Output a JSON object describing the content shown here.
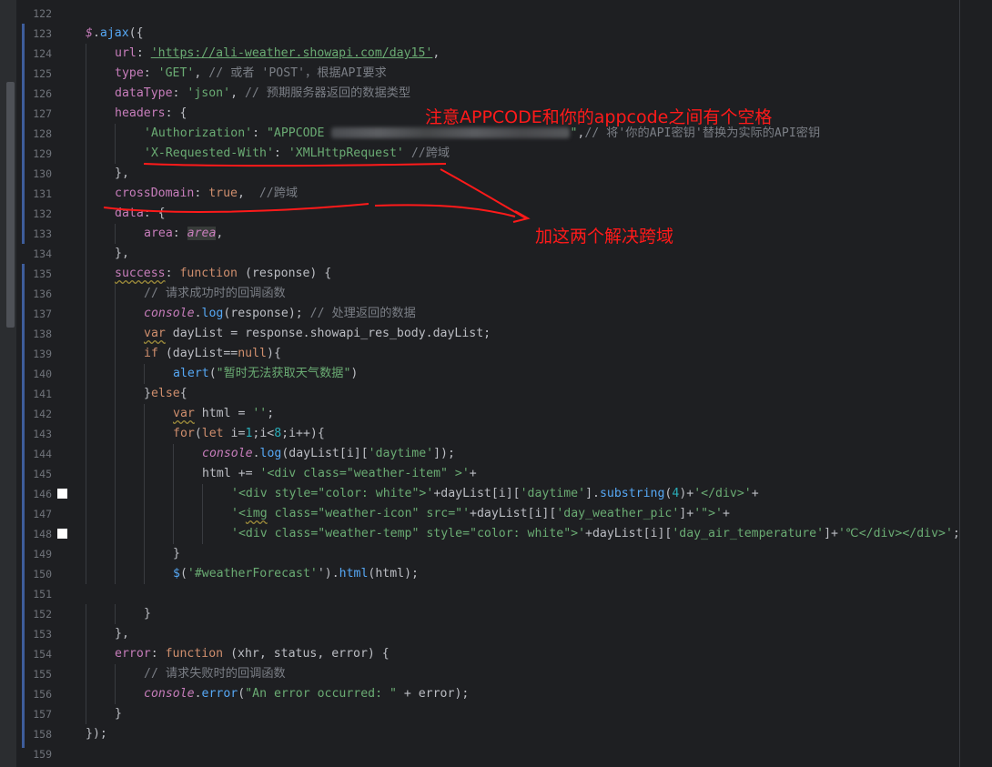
{
  "lines": [
    {
      "n": "122",
      "indent": 0,
      "bp": false,
      "t": []
    },
    {
      "n": "123",
      "indent": 0,
      "bp": false,
      "t": [
        [
          "g",
          "$"
        ],
        [
          "d",
          "."
        ],
        [
          "f",
          "ajax"
        ],
        [
          "d",
          "({"
        ]
      ]
    },
    {
      "n": "124",
      "indent": 1,
      "bp": false,
      "t": [
        [
          "p",
          "url"
        ],
        [
          "d",
          ": "
        ],
        [
          "s2",
          "'https://ali-weather.showapi.com/day15'"
        ],
        [
          "d",
          ","
        ]
      ]
    },
    {
      "n": "125",
      "indent": 1,
      "bp": false,
      "t": [
        [
          "p",
          "type"
        ],
        [
          "d",
          ": "
        ],
        [
          "s",
          "'GET'"
        ],
        [
          "d",
          ", "
        ],
        [
          "c",
          "// 或者 'POST'，根据API要求"
        ]
      ]
    },
    {
      "n": "126",
      "indent": 1,
      "bp": false,
      "t": [
        [
          "p",
          "dataType"
        ],
        [
          "d",
          ": "
        ],
        [
          "s",
          "'json'"
        ],
        [
          "d",
          ", "
        ],
        [
          "c",
          "// 预期服务器返回的数据类型"
        ]
      ]
    },
    {
      "n": "127",
      "indent": 1,
      "bp": false,
      "t": [
        [
          "p",
          "headers"
        ],
        [
          "d",
          ": {"
        ]
      ]
    },
    {
      "n": "128",
      "indent": 2,
      "bp": false,
      "t": [
        [
          "s",
          "'Authorization'"
        ],
        [
          "d",
          ": "
        ],
        [
          "s",
          "\"APPCODE "
        ],
        [
          "blur",
          ""
        ],
        [
          "s",
          "\""
        ],
        [
          "d",
          ","
        ],
        [
          "c",
          "// 将'你的API密钥'替换为实际的API密钥"
        ]
      ]
    },
    {
      "n": "129",
      "indent": 2,
      "bp": false,
      "t": [
        [
          "s",
          "'X-Requested-With'"
        ],
        [
          "d",
          ": "
        ],
        [
          "s",
          "'XMLHttpRequest'"
        ],
        [
          "d",
          " "
        ],
        [
          "c",
          "//跨域"
        ]
      ]
    },
    {
      "n": "130",
      "indent": 1,
      "bp": false,
      "t": [
        [
          "d",
          "},"
        ]
      ]
    },
    {
      "n": "131",
      "indent": 1,
      "bp": false,
      "t": [
        [
          "p",
          "crossDomain"
        ],
        [
          "d",
          ": "
        ],
        [
          "k",
          "true"
        ],
        [
          "d",
          ",  "
        ],
        [
          "c",
          "//跨域"
        ]
      ]
    },
    {
      "n": "132",
      "indent": 1,
      "bp": false,
      "t": [
        [
          "p",
          "data"
        ],
        [
          "d",
          ": {"
        ]
      ]
    },
    {
      "n": "133",
      "indent": 2,
      "bp": false,
      "t": [
        [
          "p",
          "area"
        ],
        [
          "d",
          ": "
        ],
        [
          "hl",
          "area"
        ],
        [
          "d",
          ","
        ]
      ]
    },
    {
      "n": "134",
      "indent": 1,
      "bp": false,
      "t": [
        [
          "d",
          "},"
        ]
      ]
    },
    {
      "n": "135",
      "indent": 1,
      "bp": false,
      "t": [
        [
          "pw",
          "success"
        ],
        [
          "d",
          ": "
        ],
        [
          "k",
          "function "
        ],
        [
          "d",
          "(response) {"
        ]
      ]
    },
    {
      "n": "136",
      "indent": 2,
      "bp": false,
      "t": [
        [
          "c",
          "// 请求成功时的回调函数"
        ]
      ]
    },
    {
      "n": "137",
      "indent": 2,
      "bp": false,
      "t": [
        [
          "g",
          "console"
        ],
        [
          "d",
          "."
        ],
        [
          "f",
          "log"
        ],
        [
          "d",
          "(response); "
        ],
        [
          "c",
          "// 处理返回的数据"
        ]
      ]
    },
    {
      "n": "138",
      "indent": 2,
      "bp": false,
      "t": [
        [
          "kw",
          "var"
        ],
        [
          "d",
          " dayList = response.showapi_res_body.dayList;"
        ]
      ]
    },
    {
      "n": "139",
      "indent": 2,
      "bp": false,
      "t": [
        [
          "k",
          "if "
        ],
        [
          "d",
          "(dayList=="
        ],
        [
          "k",
          "null"
        ],
        [
          "d",
          "){"
        ]
      ]
    },
    {
      "n": "140",
      "indent": 3,
      "bp": false,
      "t": [
        [
          "f",
          "alert"
        ],
        [
          "d",
          "("
        ],
        [
          "s",
          "\"暂时无法获取天气数据\""
        ],
        [
          "d",
          ")"
        ]
      ]
    },
    {
      "n": "141",
      "indent": 2,
      "bp": false,
      "t": [
        [
          "d",
          "}"
        ],
        [
          "k",
          "else"
        ],
        [
          "d",
          "{"
        ]
      ]
    },
    {
      "n": "142",
      "indent": 3,
      "bp": false,
      "t": [
        [
          "kw",
          "var"
        ],
        [
          "d",
          " html = "
        ],
        [
          "s",
          "''"
        ],
        [
          "d",
          ";"
        ]
      ]
    },
    {
      "n": "143",
      "indent": 3,
      "bp": false,
      "t": [
        [
          "k",
          "for"
        ],
        [
          "d",
          "("
        ],
        [
          "k",
          "let "
        ],
        [
          "d",
          "i="
        ],
        [
          "n",
          "1"
        ],
        [
          "d",
          ";i<"
        ],
        [
          "n",
          "8"
        ],
        [
          "d",
          ";i++){"
        ]
      ]
    },
    {
      "n": "144",
      "indent": 4,
      "bp": false,
      "t": [
        [
          "g",
          "console"
        ],
        [
          "d",
          "."
        ],
        [
          "f",
          "log"
        ],
        [
          "d",
          "(dayList[i]["
        ],
        [
          "s",
          "'daytime'"
        ],
        [
          "d",
          "]);"
        ]
      ]
    },
    {
      "n": "145",
      "indent": 4,
      "bp": false,
      "t": [
        [
          "d",
          "html += "
        ],
        [
          "s",
          "'<div class=\"weather-item\" >'"
        ],
        [
          "d",
          "+"
        ]
      ]
    },
    {
      "n": "146",
      "indent": 5,
      "bp": true,
      "t": [
        [
          "s",
          "'<div style=\"color: white\">'"
        ],
        [
          "d",
          "+dayList[i]["
        ],
        [
          "s",
          "'daytime'"
        ],
        [
          "d",
          "]."
        ],
        [
          "f",
          "substring"
        ],
        [
          "d",
          "("
        ],
        [
          "n",
          "4"
        ],
        [
          "d",
          ")+"
        ],
        [
          "s",
          "'</div>'"
        ],
        [
          "d",
          "+"
        ]
      ]
    },
    {
      "n": "147",
      "indent": 5,
      "bp": false,
      "t": [
        [
          "s",
          "'<"
        ],
        [
          "sw",
          "img"
        ],
        [
          "s",
          " class=\"weather-icon\" src=\"'"
        ],
        [
          "d",
          "+dayList[i]["
        ],
        [
          "s",
          "'day_weather_pic'"
        ],
        [
          "d",
          "]+"
        ],
        [
          "s",
          "'\">'"
        ],
        [
          "d",
          "+"
        ]
      ]
    },
    {
      "n": "148",
      "indent": 5,
      "bp": true,
      "t": [
        [
          "s",
          "'<div class=\"weather-temp\" style=\"color: white\">'"
        ],
        [
          "d",
          "+dayList[i]["
        ],
        [
          "s",
          "'day_air_temperature'"
        ],
        [
          "d",
          "]+"
        ],
        [
          "s",
          "'℃</div></div>'"
        ],
        [
          "d",
          ";"
        ]
      ]
    },
    {
      "n": "149",
      "indent": 3,
      "bp": false,
      "t": [
        [
          "d",
          "}"
        ]
      ]
    },
    {
      "n": "150",
      "indent": 3,
      "bp": false,
      "t": [
        [
          "f",
          "$"
        ],
        [
          "d",
          "("
        ],
        [
          "s",
          "'#weatherForecast'"
        ],
        [
          "d",
          "')."
        ],
        [
          "f",
          "html"
        ],
        [
          "d",
          "(html);"
        ]
      ]
    },
    {
      "n": "151",
      "indent": 0,
      "bp": false,
      "t": []
    },
    {
      "n": "152",
      "indent": 2,
      "bp": false,
      "t": [
        [
          "d",
          "}"
        ]
      ]
    },
    {
      "n": "153",
      "indent": 1,
      "bp": false,
      "t": [
        [
          "d",
          "},"
        ]
      ]
    },
    {
      "n": "154",
      "indent": 1,
      "bp": false,
      "t": [
        [
          "p",
          "error"
        ],
        [
          "d",
          ": "
        ],
        [
          "k",
          "function "
        ],
        [
          "d",
          "(xhr, status, error) {"
        ]
      ]
    },
    {
      "n": "155",
      "indent": 2,
      "bp": false,
      "t": [
        [
          "c",
          "// 请求失败时的回调函数"
        ]
      ]
    },
    {
      "n": "156",
      "indent": 2,
      "bp": false,
      "t": [
        [
          "g",
          "console"
        ],
        [
          "d",
          "."
        ],
        [
          "f",
          "error"
        ],
        [
          "d",
          "("
        ],
        [
          "s",
          "\"An error occurred: \""
        ],
        [
          "d",
          " + error);"
        ]
      ]
    },
    {
      "n": "157",
      "indent": 1,
      "bp": false,
      "t": [
        [
          "d",
          "}"
        ]
      ]
    },
    {
      "n": "158",
      "indent": 0,
      "bp": false,
      "t": [
        [
          "d",
          "});"
        ]
      ]
    },
    {
      "n": "159",
      "indent": 0,
      "bp": false,
      "t": []
    }
  ],
  "annotations": {
    "note1": "注意APPCODE和你的appcode之间有个空格",
    "note2": "加这两个解决跨域"
  },
  "colors": {
    "annotation": "#ff1a1a",
    "background": "#1e1f22"
  }
}
